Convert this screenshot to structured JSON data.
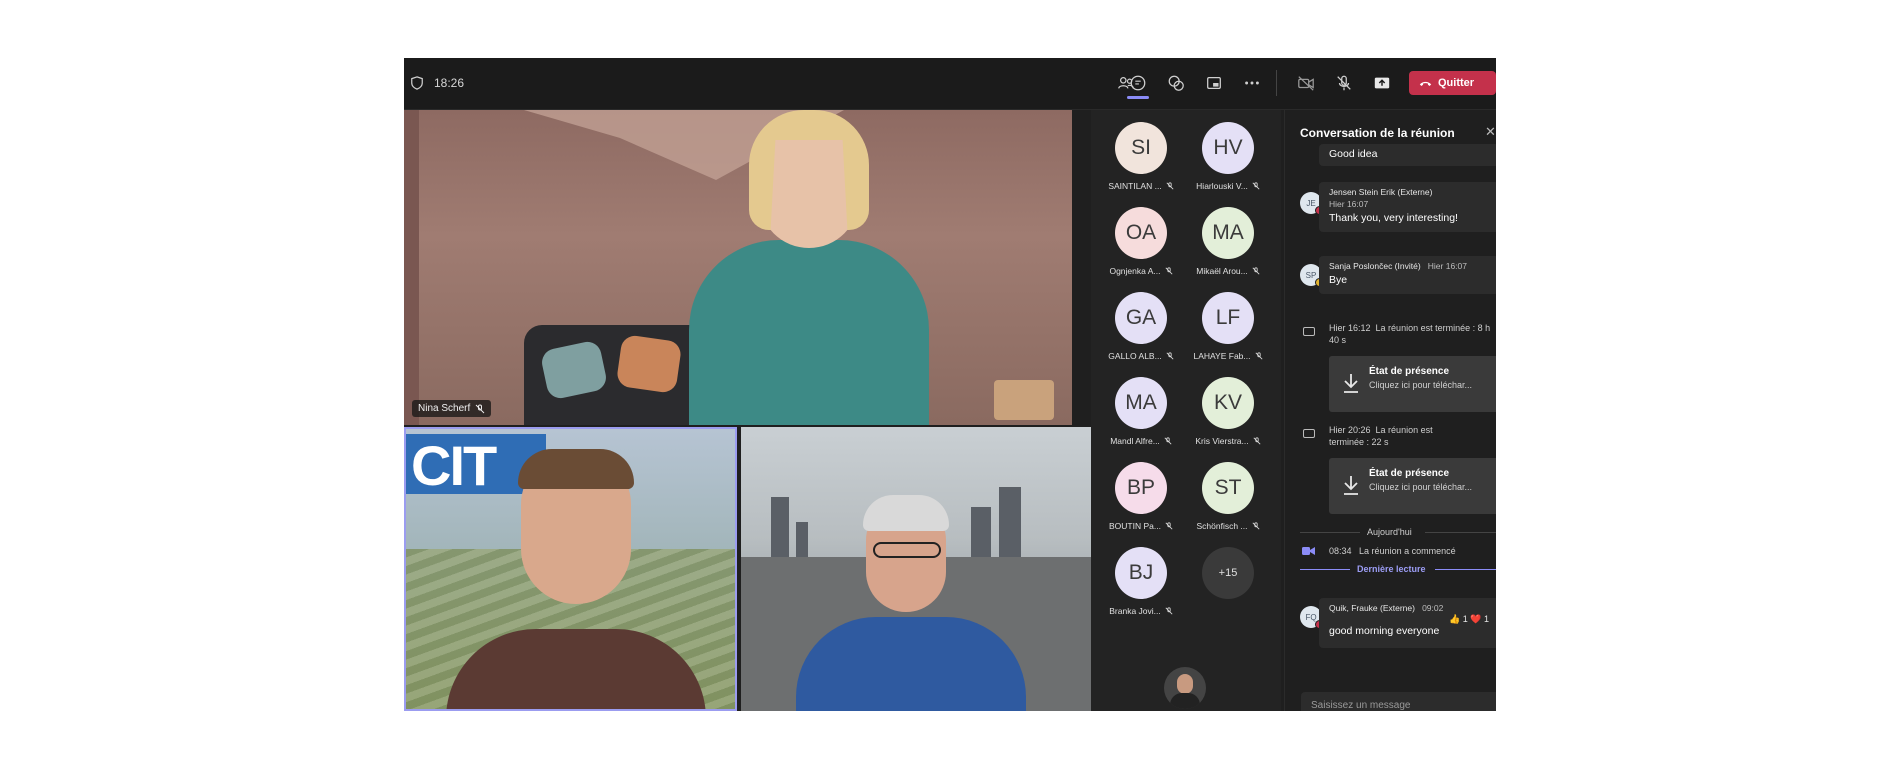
{
  "topbar": {
    "time": "18:26",
    "icons": [
      "shield-icon",
      "people-icon",
      "chat-icon",
      "reactions-icon",
      "share-tray-icon",
      "more-icon",
      "camera-off-icon",
      "mic-off-icon",
      "share-screen-icon"
    ],
    "leave_label": "Quitter"
  },
  "videos": [
    {
      "name": "Nina Scherf"
    }
  ],
  "participants": [
    {
      "initials": "SI",
      "name": "SAINTILAN ...",
      "color": "#f1e4dc"
    },
    {
      "initials": "HV",
      "name": "Hiarlouski V...",
      "color": "#e4e0f6"
    },
    {
      "initials": "OA",
      "name": "Ognjenka A...",
      "color": "#f6dcdc"
    },
    {
      "initials": "MA",
      "name": "Mikaël Arou...",
      "color": "#e3efd9"
    },
    {
      "initials": "GA",
      "name": "GALLO ALB...",
      "color": "#e4e0f6"
    },
    {
      "initials": "LF",
      "name": "LAHAYE Fab...",
      "color": "#e4e0f6"
    },
    {
      "initials": "MA",
      "name": "Mandl Alfre...",
      "color": "#e4e0f6"
    },
    {
      "initials": "KV",
      "name": "Kris Vierstra...",
      "color": "#e3efd9"
    },
    {
      "initials": "BP",
      "name": "BOUTIN Pa...",
      "color": "#f6dcea"
    },
    {
      "initials": "ST",
      "name": "Schönfisch ...",
      "color": "#e3efd9"
    },
    {
      "initials": "BJ",
      "name": "Branka Jovi...",
      "color": "#e4e0f6"
    }
  ],
  "more_count": "+15",
  "chat": {
    "title": "Conversation de la réunion",
    "messages": [
      {
        "text": "Good idea"
      },
      {
        "avatar": "JE",
        "author": "Jensen Stein Erik (Externe)",
        "time": "Hier 16:07",
        "text": "Thank you, very interesting!"
      },
      {
        "avatar": "SP",
        "author": "Sanja Poslončec (Invité)",
        "time": "Hier 16:07",
        "text": "Bye"
      }
    ],
    "system": [
      {
        "time": "Hier 16:12",
        "text": "La réunion est terminée : 8 h 40 s"
      },
      {
        "time": "Hier 20:26",
        "text": "La réunion est terminée : 22 s"
      }
    ],
    "cards": [
      {
        "title": "État de présence",
        "subtitle": "Cliquez ici pour téléchar..."
      },
      {
        "title": "État de présence",
        "subtitle": "Cliquez ici pour téléchar..."
      }
    ],
    "today_label": "Aujourd'hui",
    "started": {
      "time": "08:34",
      "text": "La réunion a commencé"
    },
    "last_read": "Dernière lecture",
    "last_message": {
      "avatar": "FQ",
      "author": "Quik, Frauke (Externe)",
      "time": "09:02",
      "text": "good morning everyone",
      "reactions": [
        {
          "emoji": "👍",
          "count": "1"
        },
        {
          "emoji": "❤️",
          "count": "1"
        }
      ]
    },
    "composer_placeholder": "Saisissez un message"
  }
}
